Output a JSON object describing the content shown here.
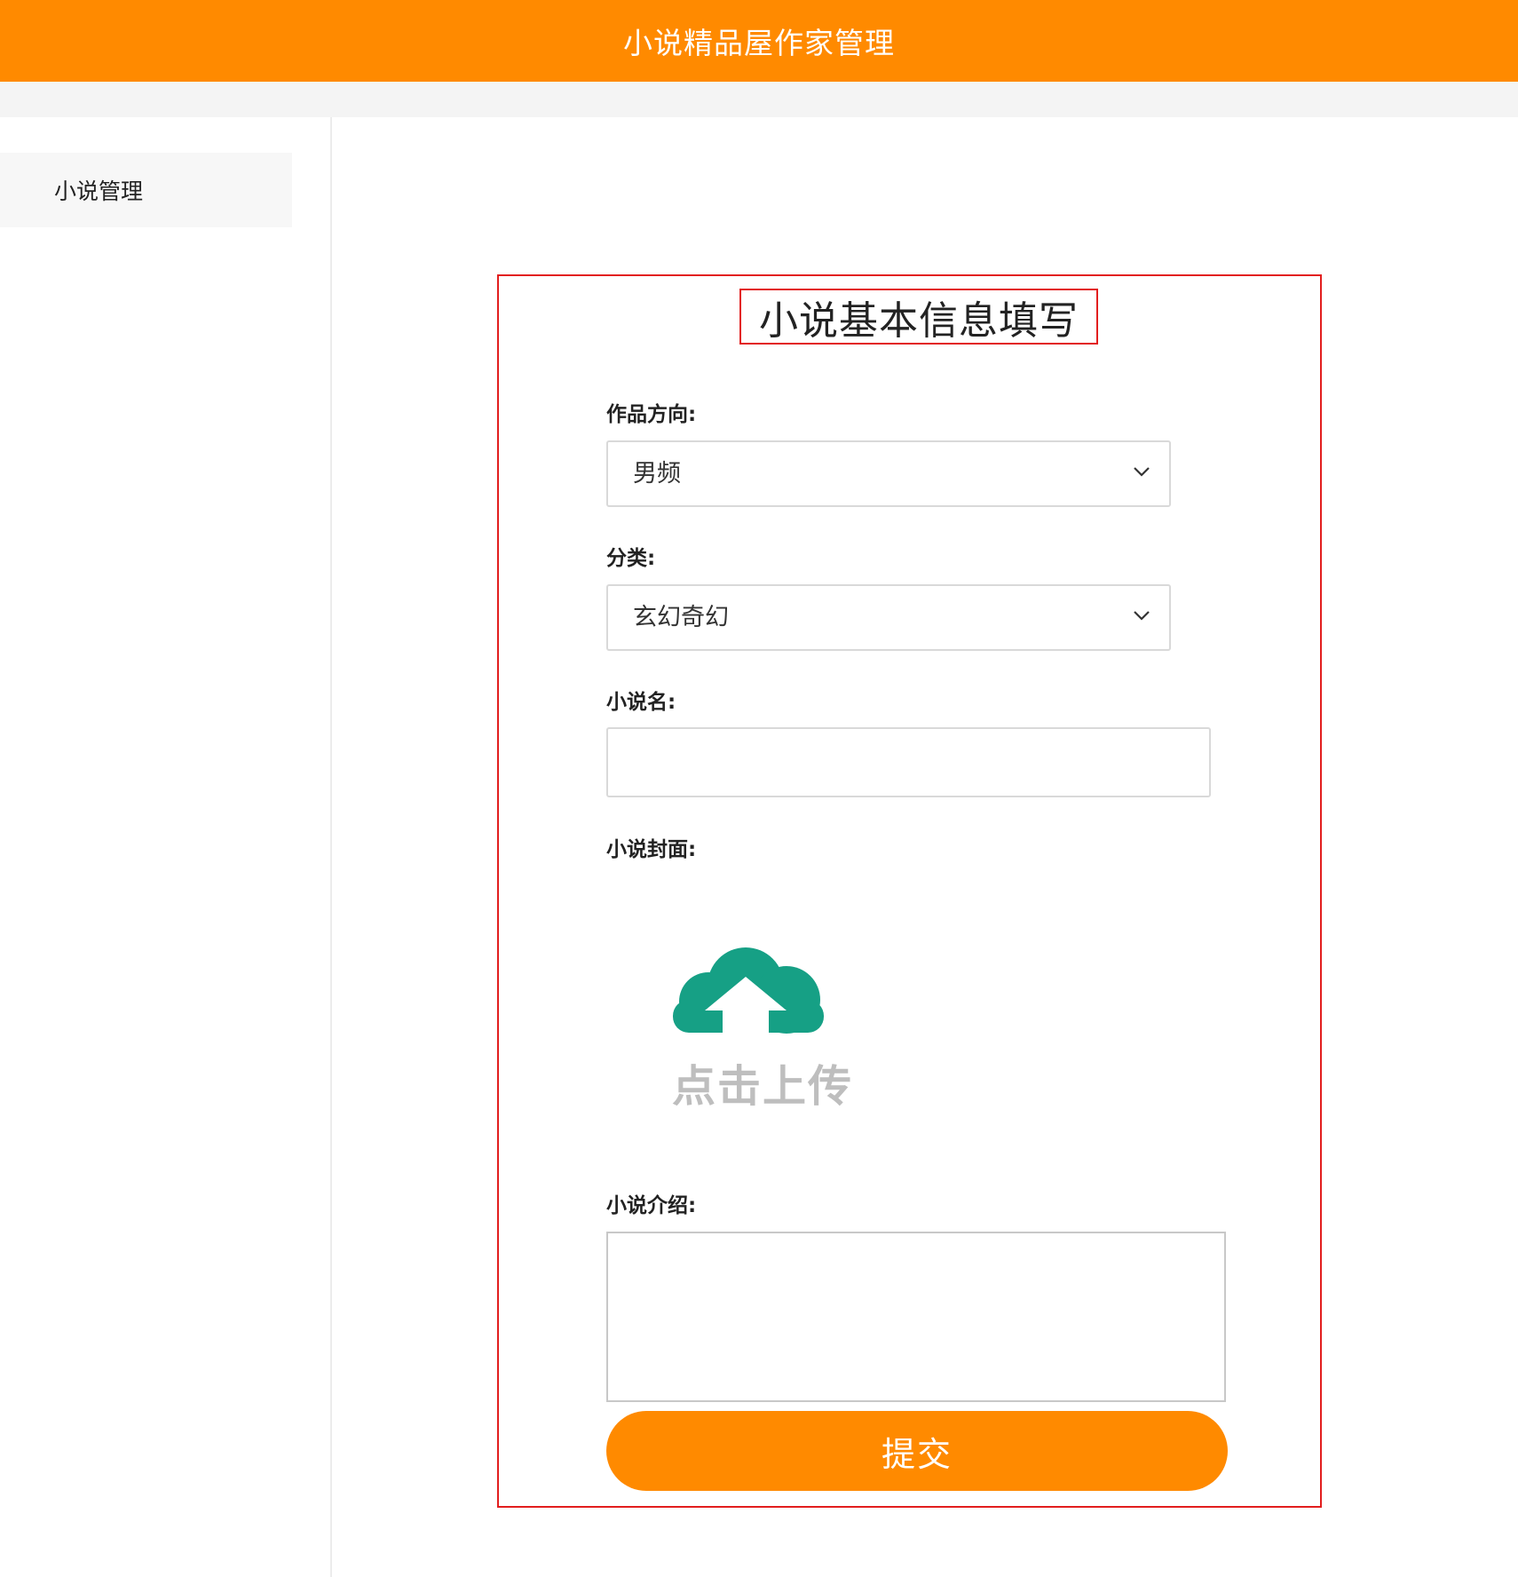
{
  "header": {
    "title": "小说精品屋作家管理"
  },
  "sidebar": {
    "items": [
      {
        "label": "小说管理"
      }
    ]
  },
  "form": {
    "title": "小说基本信息填写",
    "direction": {
      "label": "作品方向:",
      "value": "男频"
    },
    "category": {
      "label": "分类:",
      "value": "玄幻奇幻"
    },
    "name": {
      "label": "小说名:",
      "value": "",
      "placeholder": ""
    },
    "cover": {
      "label": "小说封面:",
      "upload_text": "点击上传",
      "icon": "cloud-upload-icon"
    },
    "intro": {
      "label": "小说介绍:",
      "value": ""
    },
    "submit_label": "提交"
  },
  "colors": {
    "brand_orange": "#FF8A00",
    "highlight_red": "#e21e1e",
    "upload_teal": "#16A085"
  }
}
